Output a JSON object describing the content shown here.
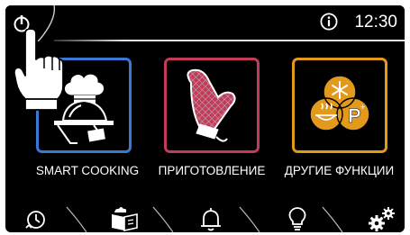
{
  "header": {
    "time": "12:30",
    "info_icon": "info-circle-icon",
    "power_icon": "power-icon"
  },
  "tiles": [
    {
      "label": "SMART COOKING",
      "icon": "chef-cloche-icon",
      "color": "#3a78d6"
    },
    {
      "label": "ПРИГОТОВЛЕНИЕ",
      "icon": "oven-mitt-icon",
      "color": "#c23b5a"
    },
    {
      "label": "ДРУГИЕ ФУНКЦИИ",
      "icon": "functions-circles-icon",
      "color": "#e39a1c"
    }
  ],
  "bottom_bar": [
    {
      "icon": "timer-icon"
    },
    {
      "icon": "recipe-book-icon"
    },
    {
      "icon": "bell-icon"
    },
    {
      "icon": "lightbulb-icon"
    },
    {
      "icon": "settings-gears-icon"
    }
  ]
}
